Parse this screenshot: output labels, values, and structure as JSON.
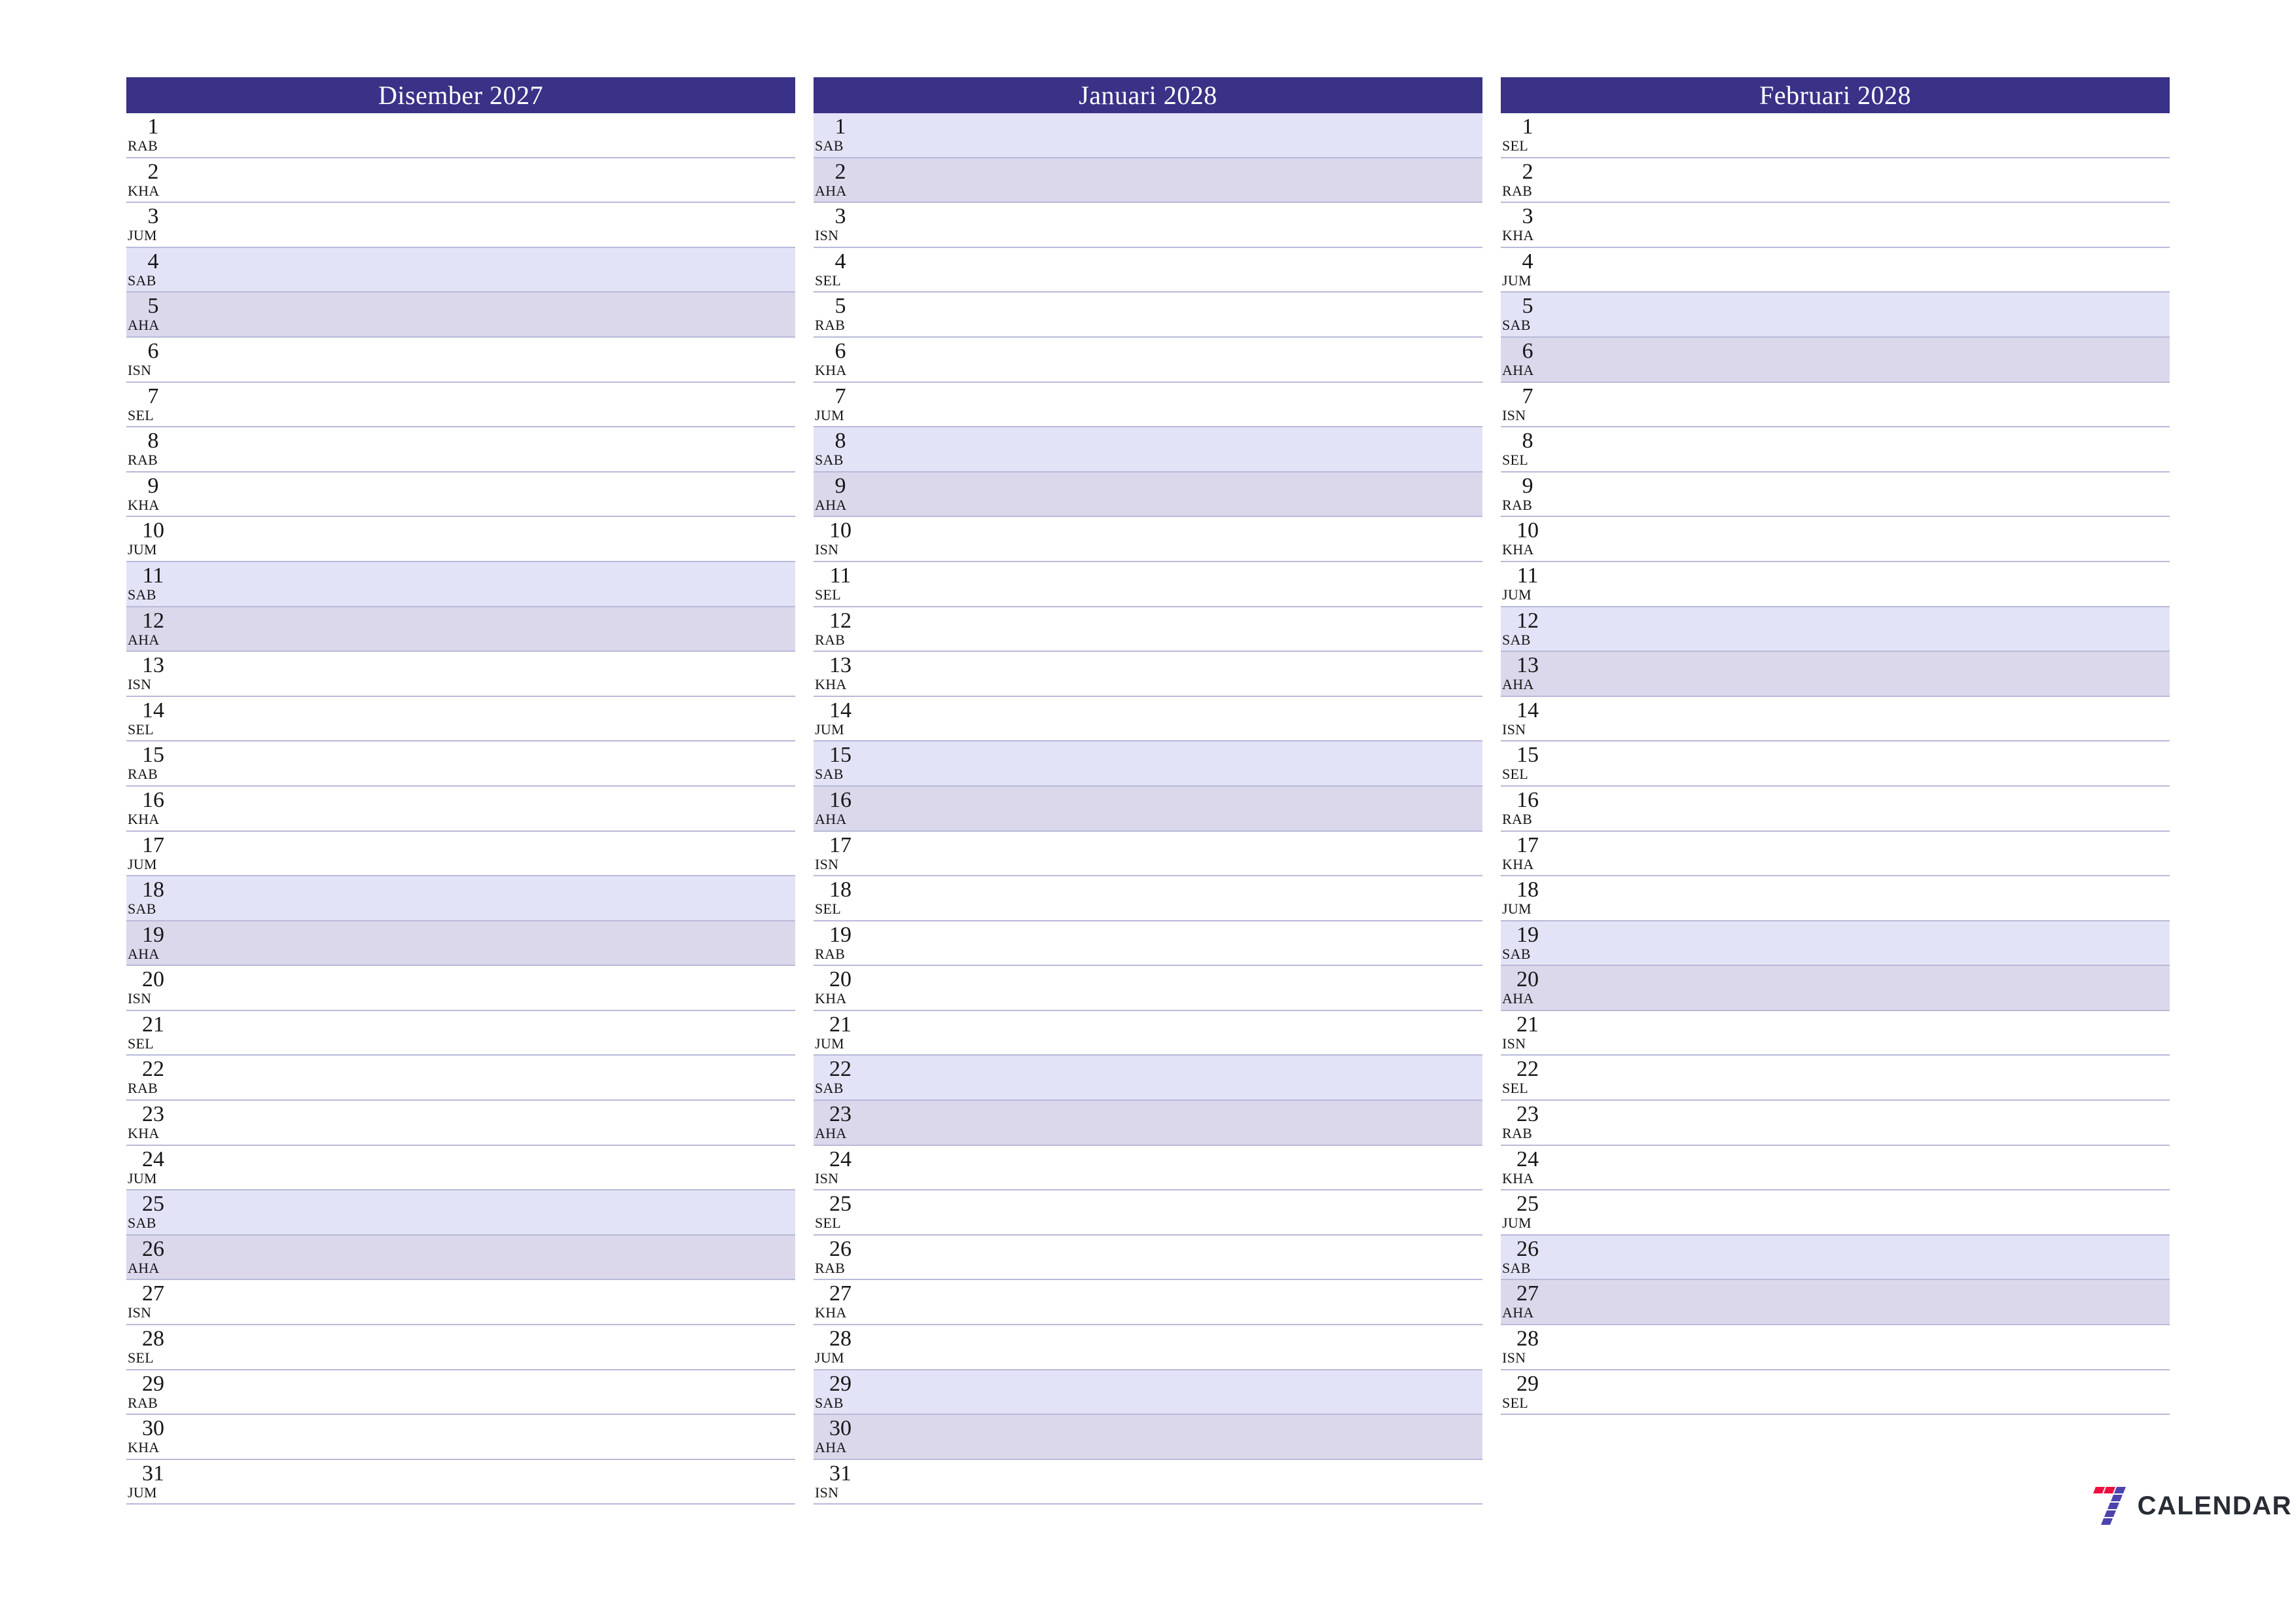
{
  "colors": {
    "header_bg": "#3a3287",
    "header_text": "#ffffff",
    "saturday_bg": "#e3e3f7",
    "sunday_bg": "#dbd8ec",
    "row_border": "#b9b9d8",
    "logo_red": "#f01040",
    "logo_purple": "#4e43ad",
    "logo_word": "#282c34"
  },
  "logo": {
    "mark_name": "seven-logo-mark",
    "word": "CALENDAR"
  },
  "day_abbreviations": {
    "monday": "ISN",
    "tuesday": "SEL",
    "wednesday": "RAB",
    "thursday": "KHA",
    "friday": "JUM",
    "saturday": "SAB",
    "sunday": "AHA"
  },
  "months": [
    {
      "title": "Disember 2027",
      "days": [
        {
          "num": "1",
          "abbr": "RAB",
          "type": "weekday"
        },
        {
          "num": "2",
          "abbr": "KHA",
          "type": "weekday"
        },
        {
          "num": "3",
          "abbr": "JUM",
          "type": "weekday"
        },
        {
          "num": "4",
          "abbr": "SAB",
          "type": "sat"
        },
        {
          "num": "5",
          "abbr": "AHA",
          "type": "sun"
        },
        {
          "num": "6",
          "abbr": "ISN",
          "type": "weekday"
        },
        {
          "num": "7",
          "abbr": "SEL",
          "type": "weekday"
        },
        {
          "num": "8",
          "abbr": "RAB",
          "type": "weekday"
        },
        {
          "num": "9",
          "abbr": "KHA",
          "type": "weekday"
        },
        {
          "num": "10",
          "abbr": "JUM",
          "type": "weekday"
        },
        {
          "num": "11",
          "abbr": "SAB",
          "type": "sat"
        },
        {
          "num": "12",
          "abbr": "AHA",
          "type": "sun"
        },
        {
          "num": "13",
          "abbr": "ISN",
          "type": "weekday"
        },
        {
          "num": "14",
          "abbr": "SEL",
          "type": "weekday"
        },
        {
          "num": "15",
          "abbr": "RAB",
          "type": "weekday"
        },
        {
          "num": "16",
          "abbr": "KHA",
          "type": "weekday"
        },
        {
          "num": "17",
          "abbr": "JUM",
          "type": "weekday"
        },
        {
          "num": "18",
          "abbr": "SAB",
          "type": "sat"
        },
        {
          "num": "19",
          "abbr": "AHA",
          "type": "sun"
        },
        {
          "num": "20",
          "abbr": "ISN",
          "type": "weekday"
        },
        {
          "num": "21",
          "abbr": "SEL",
          "type": "weekday"
        },
        {
          "num": "22",
          "abbr": "RAB",
          "type": "weekday"
        },
        {
          "num": "23",
          "abbr": "KHA",
          "type": "weekday"
        },
        {
          "num": "24",
          "abbr": "JUM",
          "type": "weekday"
        },
        {
          "num": "25",
          "abbr": "SAB",
          "type": "sat"
        },
        {
          "num": "26",
          "abbr": "AHA",
          "type": "sun"
        },
        {
          "num": "27",
          "abbr": "ISN",
          "type": "weekday"
        },
        {
          "num": "28",
          "abbr": "SEL",
          "type": "weekday"
        },
        {
          "num": "29",
          "abbr": "RAB",
          "type": "weekday"
        },
        {
          "num": "30",
          "abbr": "KHA",
          "type": "weekday"
        },
        {
          "num": "31",
          "abbr": "JUM",
          "type": "weekday"
        }
      ]
    },
    {
      "title": "Januari 2028",
      "days": [
        {
          "num": "1",
          "abbr": "SAB",
          "type": "sat"
        },
        {
          "num": "2",
          "abbr": "AHA",
          "type": "sun"
        },
        {
          "num": "3",
          "abbr": "ISN",
          "type": "weekday"
        },
        {
          "num": "4",
          "abbr": "SEL",
          "type": "weekday"
        },
        {
          "num": "5",
          "abbr": "RAB",
          "type": "weekday"
        },
        {
          "num": "6",
          "abbr": "KHA",
          "type": "weekday"
        },
        {
          "num": "7",
          "abbr": "JUM",
          "type": "weekday"
        },
        {
          "num": "8",
          "abbr": "SAB",
          "type": "sat"
        },
        {
          "num": "9",
          "abbr": "AHA",
          "type": "sun"
        },
        {
          "num": "10",
          "abbr": "ISN",
          "type": "weekday"
        },
        {
          "num": "11",
          "abbr": "SEL",
          "type": "weekday"
        },
        {
          "num": "12",
          "abbr": "RAB",
          "type": "weekday"
        },
        {
          "num": "13",
          "abbr": "KHA",
          "type": "weekday"
        },
        {
          "num": "14",
          "abbr": "JUM",
          "type": "weekday"
        },
        {
          "num": "15",
          "abbr": "SAB",
          "type": "sat"
        },
        {
          "num": "16",
          "abbr": "AHA",
          "type": "sun"
        },
        {
          "num": "17",
          "abbr": "ISN",
          "type": "weekday"
        },
        {
          "num": "18",
          "abbr": "SEL",
          "type": "weekday"
        },
        {
          "num": "19",
          "abbr": "RAB",
          "type": "weekday"
        },
        {
          "num": "20",
          "abbr": "KHA",
          "type": "weekday"
        },
        {
          "num": "21",
          "abbr": "JUM",
          "type": "weekday"
        },
        {
          "num": "22",
          "abbr": "SAB",
          "type": "sat"
        },
        {
          "num": "23",
          "abbr": "AHA",
          "type": "sun"
        },
        {
          "num": "24",
          "abbr": "ISN",
          "type": "weekday"
        },
        {
          "num": "25",
          "abbr": "SEL",
          "type": "weekday"
        },
        {
          "num": "26",
          "abbr": "RAB",
          "type": "weekday"
        },
        {
          "num": "27",
          "abbr": "KHA",
          "type": "weekday"
        },
        {
          "num": "28",
          "abbr": "JUM",
          "type": "weekday"
        },
        {
          "num": "29",
          "abbr": "SAB",
          "type": "sat"
        },
        {
          "num": "30",
          "abbr": "AHA",
          "type": "sun"
        },
        {
          "num": "31",
          "abbr": "ISN",
          "type": "weekday"
        }
      ]
    },
    {
      "title": "Februari 2028",
      "days": [
        {
          "num": "1",
          "abbr": "SEL",
          "type": "weekday"
        },
        {
          "num": "2",
          "abbr": "RAB",
          "type": "weekday"
        },
        {
          "num": "3",
          "abbr": "KHA",
          "type": "weekday"
        },
        {
          "num": "4",
          "abbr": "JUM",
          "type": "weekday"
        },
        {
          "num": "5",
          "abbr": "SAB",
          "type": "sat"
        },
        {
          "num": "6",
          "abbr": "AHA",
          "type": "sun"
        },
        {
          "num": "7",
          "abbr": "ISN",
          "type": "weekday"
        },
        {
          "num": "8",
          "abbr": "SEL",
          "type": "weekday"
        },
        {
          "num": "9",
          "abbr": "RAB",
          "type": "weekday"
        },
        {
          "num": "10",
          "abbr": "KHA",
          "type": "weekday"
        },
        {
          "num": "11",
          "abbr": "JUM",
          "type": "weekday"
        },
        {
          "num": "12",
          "abbr": "SAB",
          "type": "sat"
        },
        {
          "num": "13",
          "abbr": "AHA",
          "type": "sun"
        },
        {
          "num": "14",
          "abbr": "ISN",
          "type": "weekday"
        },
        {
          "num": "15",
          "abbr": "SEL",
          "type": "weekday"
        },
        {
          "num": "16",
          "abbr": "RAB",
          "type": "weekday"
        },
        {
          "num": "17",
          "abbr": "KHA",
          "type": "weekday"
        },
        {
          "num": "18",
          "abbr": "JUM",
          "type": "weekday"
        },
        {
          "num": "19",
          "abbr": "SAB",
          "type": "sat"
        },
        {
          "num": "20",
          "abbr": "AHA",
          "type": "sun"
        },
        {
          "num": "21",
          "abbr": "ISN",
          "type": "weekday"
        },
        {
          "num": "22",
          "abbr": "SEL",
          "type": "weekday"
        },
        {
          "num": "23",
          "abbr": "RAB",
          "type": "weekday"
        },
        {
          "num": "24",
          "abbr": "KHA",
          "type": "weekday"
        },
        {
          "num": "25",
          "abbr": "JUM",
          "type": "weekday"
        },
        {
          "num": "26",
          "abbr": "SAB",
          "type": "sat"
        },
        {
          "num": "27",
          "abbr": "AHA",
          "type": "sun"
        },
        {
          "num": "28",
          "abbr": "ISN",
          "type": "weekday"
        },
        {
          "num": "29",
          "abbr": "SEL",
          "type": "weekday"
        }
      ]
    }
  ]
}
